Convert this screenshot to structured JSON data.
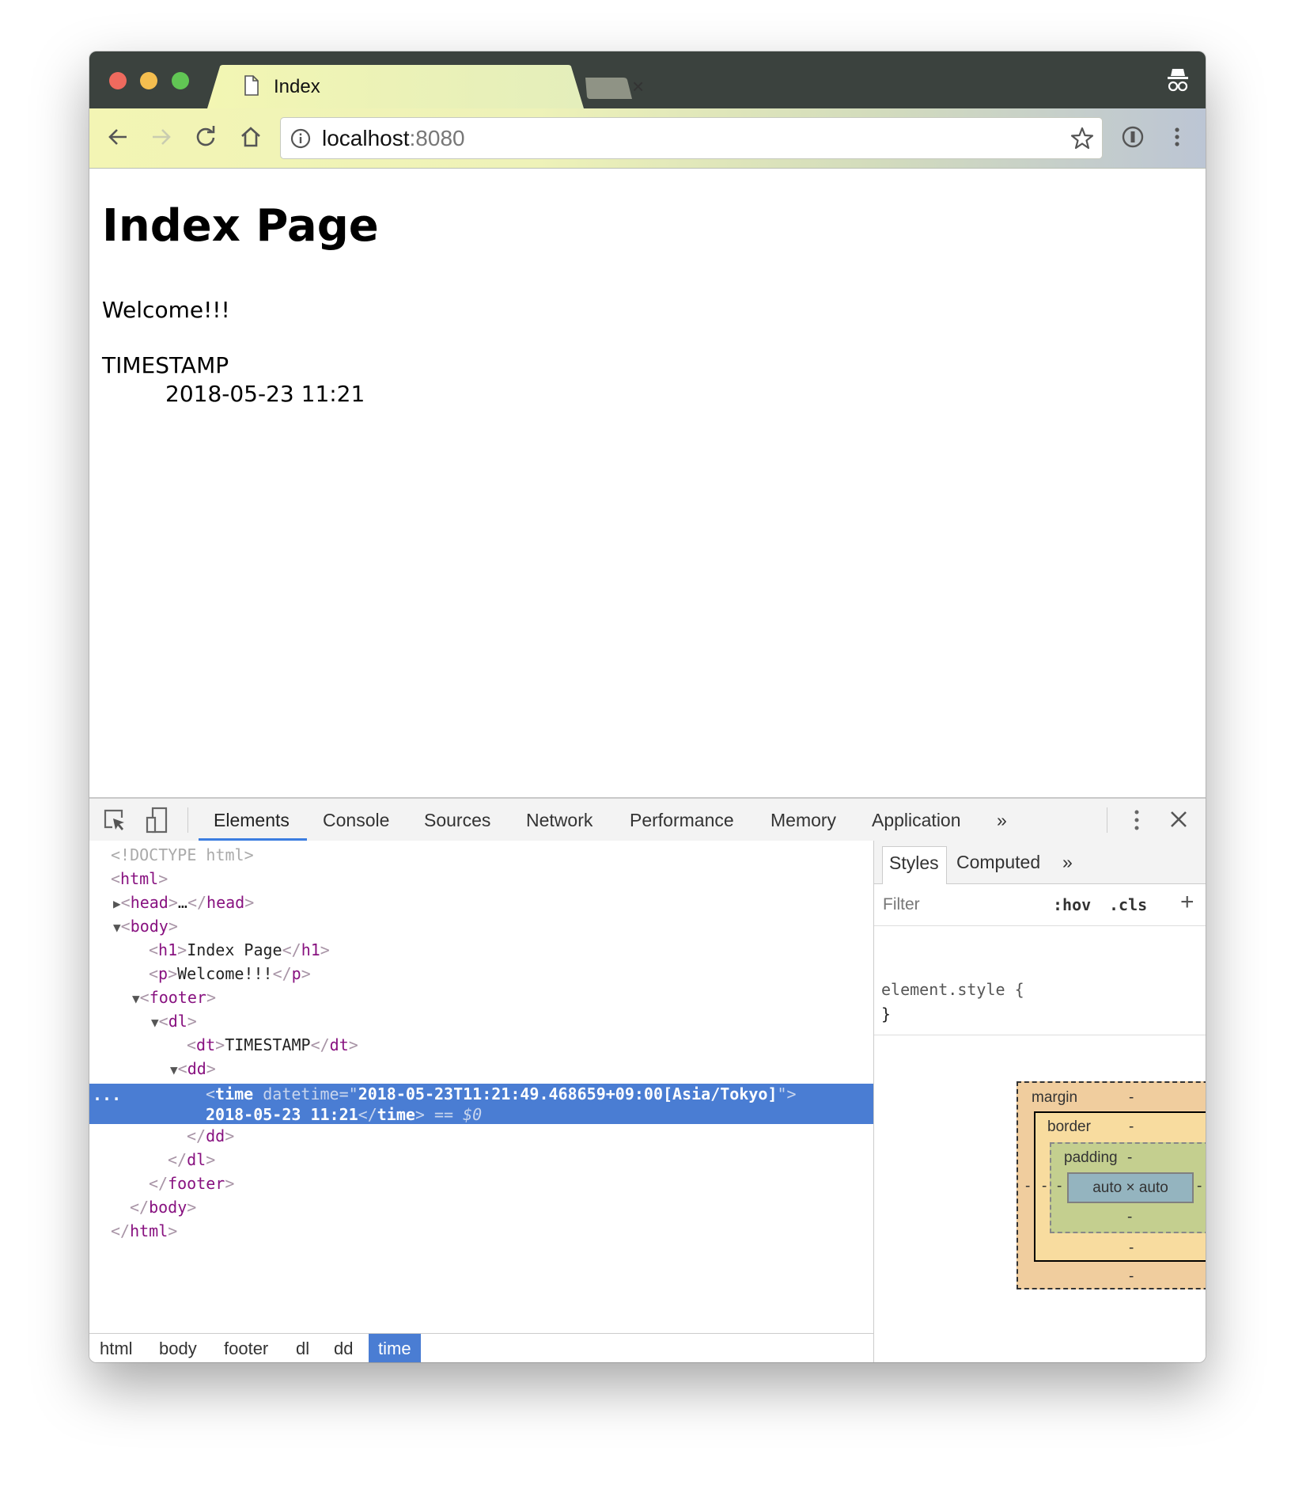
{
  "browser": {
    "tab_title": "Index",
    "url_host": "localhost",
    "url_port": ":8080"
  },
  "page": {
    "heading": "Index Page",
    "welcome": "Welcome!!!",
    "timestamp_label": "TIMESTAMP",
    "timestamp_value": "2018-05-23 11:21"
  },
  "devtools": {
    "tabs": [
      "Elements",
      "Console",
      "Sources",
      "Network",
      "Performance",
      "Memory",
      "Application"
    ],
    "more": "»",
    "dom": {
      "doctype": "<!DOCTYPE html>",
      "html_open": "html",
      "head": "head",
      "ellipsis": "…",
      "body": "body",
      "h1": "h1",
      "h1_text": "Index Page",
      "p": "p",
      "p_text": "Welcome!!!",
      "footer": "footer",
      "dl": "dl",
      "dt": "dt",
      "dt_text": "TIMESTAMP",
      "dd": "dd",
      "time": "time",
      "attr_name": "datetime",
      "attr_value": "2018-05-23T11:21:49.468659+09:00[Asia/Tokyo]",
      "time_text": "2018-05-23 11:21",
      "eq_ref": "== $0",
      "row_dots": "..."
    },
    "styles": {
      "tabs": [
        "Styles",
        "Computed"
      ],
      "more": "»",
      "filter_placeholder": "Filter",
      "hov": ":hov",
      "cls": ".cls",
      "add": "+",
      "element_style": "element.style {",
      "close_brace": "}",
      "box_model": {
        "margin": "margin",
        "border": "border",
        "padding": "padding",
        "content": "auto × auto",
        "dash": "-"
      }
    },
    "breadcrumbs": [
      "html",
      "body",
      "footer",
      "dl",
      "dd",
      "time"
    ]
  },
  "colors": {
    "selection": "#4a7dd3",
    "tag": "#881280",
    "tabbar": "#3b423e"
  }
}
